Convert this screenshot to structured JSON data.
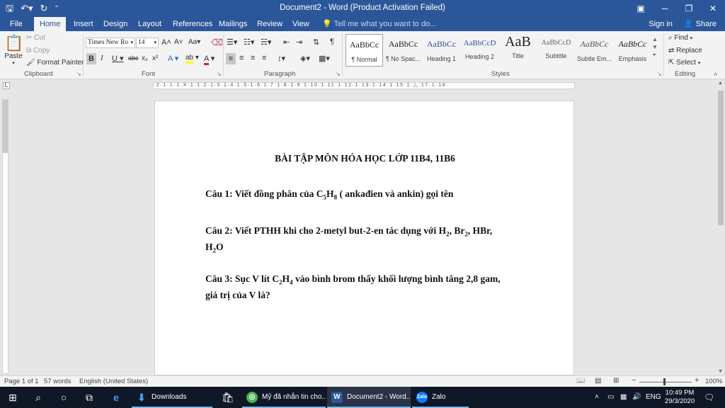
{
  "window": {
    "title": "Document2 - Word (Product Activation Failed)",
    "minimize_icon": "minimize-icon",
    "restore_icon": "restore-icon",
    "close_icon": "close-icon"
  },
  "tabs": [
    "File",
    "Home",
    "Insert",
    "Design",
    "Layout",
    "References",
    "Mailings",
    "Review",
    "View"
  ],
  "tell_me": "Tell me what you want to do...",
  "account": {
    "sign_in": "Sign in",
    "share": "Share"
  },
  "clipboard": {
    "paste": "Paste",
    "cut": "Cut",
    "copy": "Copy",
    "format_painter": "Format Painter",
    "label": "Clipboard"
  },
  "font": {
    "name": "Times New Ro",
    "size": "14",
    "label": "Font"
  },
  "paragraph": {
    "label": "Paragraph"
  },
  "styles": {
    "label": "Styles",
    "items": [
      {
        "preview": "AaBbCc",
        "name": "¶ Normal"
      },
      {
        "preview": "AaBbCc",
        "name": "¶ No Spac..."
      },
      {
        "preview": "AaBbCc",
        "name": "Heading 1"
      },
      {
        "preview": "AaBbCcD",
        "name": "Heading 2"
      },
      {
        "preview": "AaB",
        "name": "Title"
      },
      {
        "preview": "AaBbCcD",
        "name": "Subtitle"
      },
      {
        "preview": "AaBbCc",
        "name": "Subtle Em..."
      },
      {
        "preview": "AaBbCc",
        "name": "Emphasis"
      }
    ]
  },
  "editing": {
    "find": "Find",
    "replace": "Replace",
    "select": "Select",
    "label": "Editing"
  },
  "ruler_text": "·2·1·1·1·X·1·1·2·1·3·1·4·1·5·1·6·1·7·1·8·1·9·1·10·1·11·1·12·1·13·1·14·1·15·1·△·17·1·18·",
  "document": {
    "title": "BÀI TẬP MÔN HÓA HỌC LỚP 11B4, 11B6",
    "q1_prefix": "Câu 1: Viết đồng phân của C",
    "q1_sub1": "5",
    "q1_mid": "H",
    "q1_sub2": "8",
    "q1_suffix": " ( ankađien và ankin) gọi tên",
    "q2_prefix": "Câu 2: Viết PTHH khi cho 2-metyl but-2-en tác dụng với H",
    "q2_sub1": "2",
    "q2_mid1": ", Br",
    "q2_sub2": "2",
    "q2_mid2": ", HBr,",
    "q2_line2_a": "H",
    "q2_sub3": "2",
    "q2_line2_b": "O",
    "q3_prefix": "Câu 3: Sục V lít C",
    "q3_sub1": "2",
    "q3_mid": "H",
    "q3_sub2": "4",
    "q3_suffix": " vào bình brom thấy khối lượng bình tăng 2,8 gam,",
    "q3_line2": "giá trị của V là?"
  },
  "status": {
    "page": "Page 1 of 1",
    "words": "57 words",
    "language": "English (United States)",
    "zoom": "100%",
    "zoom_level": 1.0
  },
  "taskbar": {
    "apps": [
      {
        "label": "Downloads"
      },
      {
        "label": "Mỹ đã nhắn tin cho..."
      },
      {
        "label": "Document2 - Word..."
      },
      {
        "label": "Zalo"
      }
    ],
    "ime": "ENG",
    "time": "10:49 PM",
    "date": "29/3/2020"
  }
}
